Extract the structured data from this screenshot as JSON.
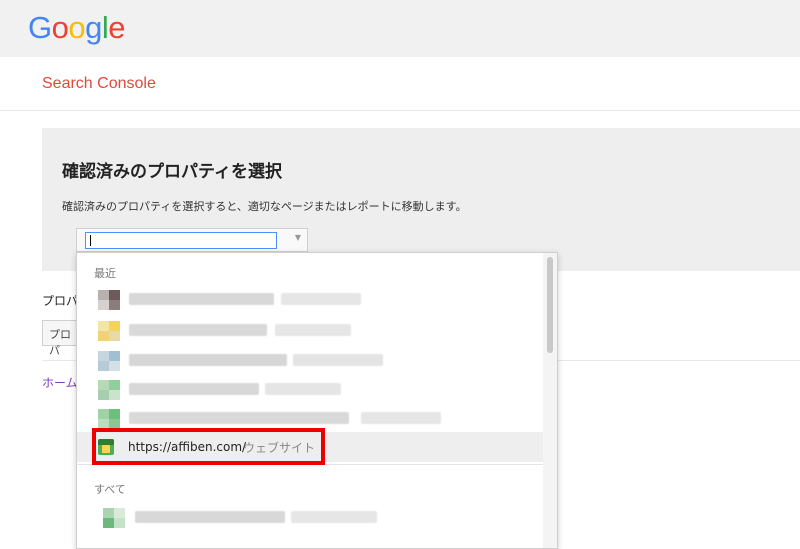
{
  "header": {
    "logo_letters": [
      {
        "ch": "G",
        "color": "#4285f4"
      },
      {
        "ch": "o",
        "color": "#ea4335"
      },
      {
        "ch": "o",
        "color": "#fbbc05"
      },
      {
        "ch": "g",
        "color": "#4285f4"
      },
      {
        "ch": "l",
        "color": "#34a853"
      },
      {
        "ch": "e",
        "color": "#ea4335"
      }
    ],
    "product_name": "Search Console"
  },
  "panel": {
    "title": "確認済みのプロパティを選択",
    "description": "確認済みのプロパティを選択すると、適切なページまたはレポートに移動します。",
    "select_value": ""
  },
  "background_partial": {
    "label": "プロパ",
    "button_label": "プロパ",
    "home_link": "ホーム"
  },
  "dropdown": {
    "recent_label": "最近",
    "all_label": "すべて",
    "highlighted_item": {
      "url": "https://affiben.com/",
      "type": "ウェブサイト"
    }
  },
  "colors": {
    "accent_red": "#dd4b39",
    "highlight_border": "#ee0000",
    "focus_blue": "#4d90fe"
  }
}
